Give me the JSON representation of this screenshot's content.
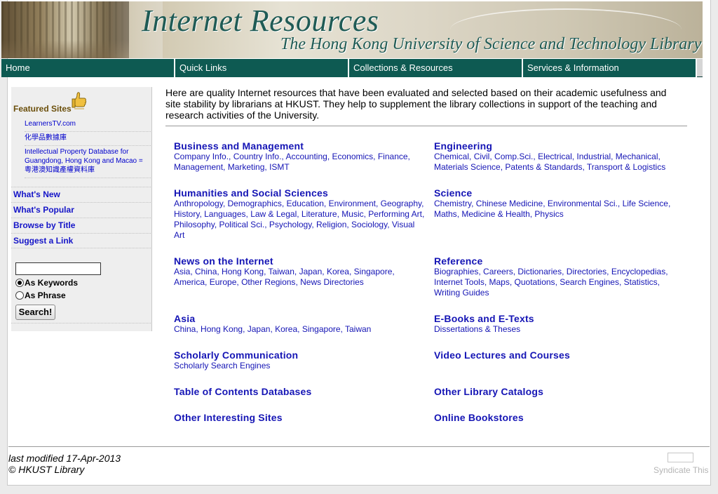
{
  "banner": {
    "title": "Internet Resources",
    "subtitle": "The Hong Kong University of Science and Technology Library"
  },
  "nav": {
    "items": [
      "Home",
      "Quick Links",
      "Collections & Resources",
      "Services & Information"
    ]
  },
  "sidebar": {
    "featured_heading": "Featured Sites",
    "featured_links": [
      "LearnersTV.com",
      "化學品數據庫",
      "Intellectual Property Database for Guangdong, Hong Kong and Macao = 粵港澳知識產權資料庫"
    ],
    "links": [
      "What's New",
      "What's Popular",
      "Browse by Title",
      "Suggest a Link"
    ],
    "search": {
      "value": "",
      "option_keywords": "As Keywords",
      "option_phrase": "As Phrase",
      "selected": "As Keywords",
      "button": "Search!"
    }
  },
  "intro": "Here are quality Internet resources that have been evaluated and selected based on their academic usefulness and site stability by librarians at HKUST.  They help to supplement the library collections in support of the teaching and research activities of the University.",
  "categories": {
    "business": {
      "title": "Business and Management",
      "subs": [
        "Company Info.",
        "Country Info.",
        "Accounting",
        "Economics",
        "Finance",
        "Management",
        "Marketing",
        "ISMT"
      ]
    },
    "engineering": {
      "title": "Engineering",
      "subs": [
        "Chemical",
        "Civil",
        "Comp.Sci.",
        "Electrical",
        "Industrial",
        "Mechanical",
        "Materials Science",
        "Patents & Standards",
        "Transport & Logistics"
      ]
    },
    "humanities": {
      "title": "Humanities and Social Sciences",
      "subs": [
        "Anthropology",
        "Demographics",
        "Education",
        "Environment",
        "Geography",
        "History",
        "Languages",
        "Law & Legal",
        "Literature",
        "Music",
        "Performing Art",
        "Philosophy",
        "Political Sci.",
        "Psychology",
        "Religion",
        "Sociology",
        "Visual Art"
      ]
    },
    "science": {
      "title": "Science",
      "subs": [
        "Chemistry",
        "Chinese Medicine",
        "Environmental Sci.",
        "Life Science",
        "Maths",
        "Medicine & Health",
        "Physics"
      ]
    },
    "news": {
      "title": "News on the Internet",
      "subs": [
        "Asia",
        "China",
        "Hong Kong",
        "Taiwan",
        "Japan",
        "Korea",
        "Singapore",
        "America",
        "Europe",
        "Other Regions",
        "News Directories"
      ]
    },
    "reference": {
      "title": "Reference",
      "subs": [
        "Biographies",
        "Careers",
        "Dictionaries",
        "Directories",
        "Encyclopedias",
        "Internet Tools",
        "Maps",
        "Quotations",
        "Search Engines",
        "Statistics",
        "Writing Guides"
      ]
    },
    "asia": {
      "title": "Asia",
      "subs": [
        "China",
        "Hong Kong",
        "Japan",
        "Korea",
        "Singapore",
        "Taiwan"
      ]
    },
    "ebooks": {
      "title": "E-Books and E-Texts",
      "subs": [
        "Dissertations & Theses"
      ]
    },
    "scholarly": {
      "title": "Scholarly Communication",
      "subs": [
        "Scholarly Search Engines"
      ]
    },
    "video": {
      "title": "Video Lectures and Courses",
      "subs": []
    },
    "toc": {
      "title": "Table of Contents Databases",
      "subs": []
    },
    "catalogs": {
      "title": "Other Library Catalogs",
      "subs": []
    },
    "interesting": {
      "title": "Other Interesting Sites",
      "subs": []
    },
    "bookstores": {
      "title": "Online Bookstores",
      "subs": []
    }
  },
  "footer": {
    "modified": "last modified 17-Apr-2013",
    "copyright": "© HKUST Library",
    "syndicate": "Syndicate This"
  },
  "icons": {
    "featured": "thumbs-up-icon"
  },
  "colors": {
    "nav_bg": "#0e5a52",
    "banner_title": "#1f5b55",
    "link": "#1515b5",
    "featured_heading": "#6b4f0b"
  }
}
